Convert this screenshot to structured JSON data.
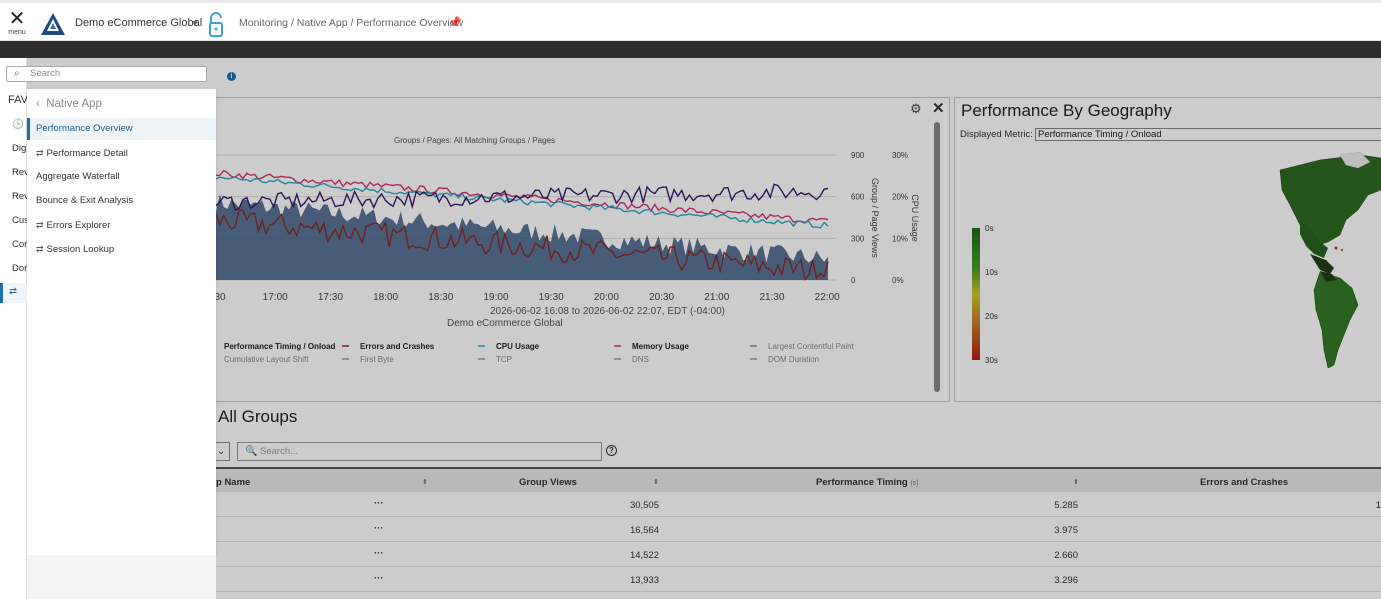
{
  "topbar": {
    "menu_label": "menu",
    "app_name": "Demo eCommerce Global",
    "breadcrumb": "Monitoring / Native App / Performance Overview"
  },
  "rail": {
    "search_placeholder": "Search",
    "fav_label": "FAV",
    "items": [
      "Dig",
      "Rev",
      "Rev",
      "Cus",
      "Cor",
      "Dor"
    ]
  },
  "flyout": {
    "back_label": "Native App",
    "items": [
      {
        "label": "Performance Overview",
        "icon": "",
        "active": true
      },
      {
        "label": "Performance Detail",
        "icon": "link-icon",
        "active": false
      },
      {
        "label": "Aggregate Waterfall",
        "icon": "",
        "active": false
      },
      {
        "label": "Bounce & Exit Analysis",
        "icon": "",
        "active": false
      },
      {
        "label": "Errors Explorer",
        "icon": "link-icon",
        "active": false
      },
      {
        "label": "Session Lookup",
        "icon": "link-icon",
        "active": false
      }
    ]
  },
  "chart_panel": {
    "subtitle": "Groups / Pages: All Matching Groups / Pages",
    "date_range": "2026-06-02 16:08 to 2026-06-02 22:07, EDT (-04:00)",
    "app_label": "Demo eCommerce Global",
    "legend_row1": [
      "Performance Timing / Onload",
      "Errors and Crashes",
      "CPU Usage",
      "Memory Usage",
      "Largest Contentful Paint"
    ],
    "legend_row2": [
      "Cumulative Layout Shift",
      "First Byte",
      "TCP",
      "DNS",
      "DOM Duration"
    ]
  },
  "chart_data": {
    "type": "area",
    "x_ticks": [
      "30",
      "17:00",
      "17:30",
      "18:00",
      "18:30",
      "19:00",
      "19:30",
      "20:00",
      "20:30",
      "21:00",
      "21:30",
      "22:00"
    ],
    "y_left_label": "Group / Page Views",
    "y_left_ticks": [
      "900",
      "600",
      "300",
      "0"
    ],
    "y_right_label": "CPU Usage",
    "y_right_ticks": [
      "30%",
      "20%",
      "10%",
      "0%"
    ],
    "ylim_left": [
      0,
      900
    ],
    "ylim_right": [
      0,
      30
    ],
    "series": [
      {
        "name": "Group / Page Views",
        "kind": "area",
        "color": "#3b5a82",
        "start": 560,
        "end": 150,
        "noise": 70
      },
      {
        "name": "Errors and Crashes",
        "kind": "line",
        "color": "#8c2a26",
        "start": 430,
        "end": 60,
        "noise": 90
      },
      {
        "name": "Memory Usage",
        "kind": "line",
        "color": "#d83577",
        "start": 770,
        "end": 420,
        "noise": 25
      },
      {
        "name": "CPU Usage",
        "kind": "line",
        "color": "#2fa6c9",
        "start": 740,
        "end": 390,
        "noise": 22
      },
      {
        "name": "Performance Timing / Onload",
        "kind": "line",
        "color": "#3b1c6e",
        "start": 560,
        "end": 640,
        "noise": 60
      }
    ]
  },
  "geo_panel": {
    "title": "Performance By Geography",
    "metric_label": "Displayed Metric:",
    "metric_value": "Performance Timing / Onload",
    "legend": [
      "0s",
      "10s",
      "20s",
      "30s"
    ]
  },
  "groups": {
    "title": "All Groups",
    "search_placeholder": "Search...",
    "help": "?",
    "columns": [
      "p Name",
      "Group Views",
      "Performance Timing",
      "Errors and Crashes"
    ],
    "perf_unit": "(s)",
    "rows": [
      {
        "views": "30,505",
        "timing": "5.285",
        "errors": "1"
      },
      {
        "views": "16,564",
        "timing": "3.975",
        "errors": ""
      },
      {
        "views": "14,522",
        "timing": "2.660",
        "errors": ""
      },
      {
        "views": "13,933",
        "timing": "3.296",
        "errors": ""
      }
    ]
  }
}
